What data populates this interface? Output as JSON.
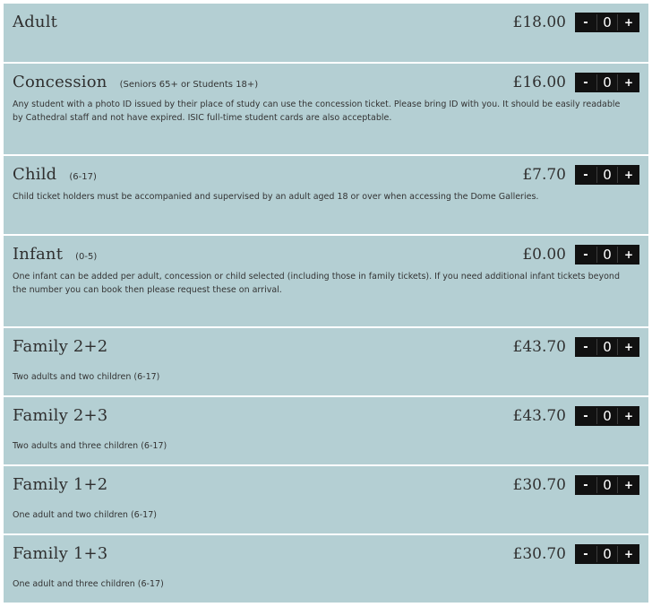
{
  "tickets": [
    {
      "name": "Adult",
      "qualifier": "",
      "price": "£18.00",
      "quantity": "0",
      "description": ""
    },
    {
      "name": "Concession",
      "qualifier": "(Seniors 65+ or Students 18+)",
      "price": "£16.00",
      "quantity": "0",
      "description": "Any student with a photo ID issued by their place of study can use the concession ticket. Please bring ID with you. It should be easily readable by Cathedral staff and not have expired. ISIC full-time student cards are also acceptable."
    },
    {
      "name": "Child",
      "qualifier": "(6-17)",
      "price": "£7.70",
      "quantity": "0",
      "description": "Child ticket holders must be accompanied and supervised by an adult aged 18 or over when accessing the Dome Galleries."
    },
    {
      "name": "Infant",
      "qualifier": "(0-5)",
      "price": "£0.00",
      "quantity": "0",
      "description": "One infant can be added per adult, concession or child selected (including those in family tickets). If you need additional infant tickets beyond the number you can book then please request these on arrival."
    },
    {
      "name": "Family 2+2",
      "qualifier": "",
      "price": "£43.70",
      "quantity": "0",
      "description": "Two adults and two children (6-17)"
    },
    {
      "name": "Family 2+3",
      "qualifier": "",
      "price": "£43.70",
      "quantity": "0",
      "description": "Two adults and three children (6-17)"
    },
    {
      "name": "Family 1+2",
      "qualifier": "",
      "price": "£30.70",
      "quantity": "0",
      "description": "One adult and two children (6-17)"
    },
    {
      "name": "Family 1+3",
      "qualifier": "",
      "price": "£30.70",
      "quantity": "0",
      "description": "One adult and three children (6-17)"
    }
  ],
  "stepper": {
    "minus_label": "-",
    "plus_label": "+"
  }
}
